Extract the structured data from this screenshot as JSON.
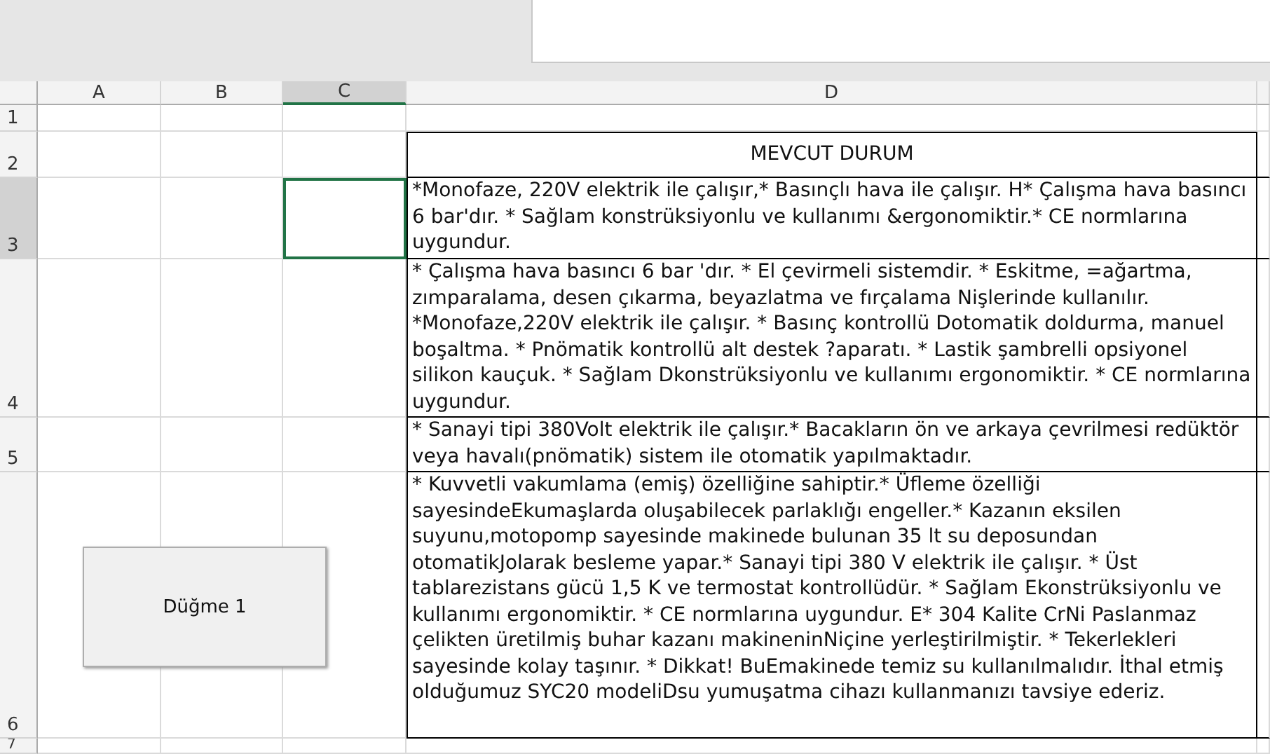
{
  "columns": [
    {
      "label": "A",
      "selected": false
    },
    {
      "label": "B",
      "selected": false
    },
    {
      "label": "C",
      "selected": true
    },
    {
      "label": "D",
      "selected": false
    }
  ],
  "rows": [
    {
      "label": "1",
      "selected": false
    },
    {
      "label": "2",
      "selected": false,
      "kind": "header",
      "text": "MEVCUT DURUM"
    },
    {
      "label": "3",
      "selected": true,
      "kind": "text",
      "text": "*Monofaze, 220V elektrik ile çalışır,* Basınçlı hava ile çalışır. H* Çalışma hava basıncı 6 bar'dır. * Sağlam konstrüksiyonlu ve kullanımı &ergonomiktir.* CE normlarına uygundur."
    },
    {
      "label": "4",
      "selected": false,
      "kind": "text",
      "text": "* Çalışma hava basıncı 6 bar 'dır. * El çevirmeli sistemdir. * Eskitme, =ağartma, zımparalama, desen çıkarma, beyazlatma ve fırçalama Nişlerinde kullanılır. *Monofaze,220V elektrik ile çalışır. * Basınç kontrollü Dotomatik doldurma, manuel boşaltma. * Pnömatik kontrollü alt destek ?aparatı. * Lastik şambrelli opsiyonel silikon kauçuk. * Sağlam Dkonstrüksiyonlu ve kullanımı ergonomiktir. * CE normlarına uygundur."
    },
    {
      "label": "5",
      "selected": false,
      "kind": "text",
      "text": "* Sanayi tipi 380Volt elektrik ile çalışır.* Bacakların ön ve arkaya çevrilmesi redüktör veya havalı(pnömatik) sistem ile otomatik yapılmaktadır."
    },
    {
      "label": "6",
      "selected": false,
      "kind": "text",
      "text": "* Kuvvetli vakumlama (emiş) özelliğine sahiptir.* Üfleme özelliği sayesindeEkumaşlarda oluşabilecek parlaklığı engeller.* Kazanın eksilen suyunu,motopomp sayesinde makinede bulunan 35 lt su deposundan otomatikJolarak besleme yapar.* Sanayi tipi 380 V elektrik ile çalışır. * Üst tablarezistans  gücü 1,5 K  ve termostat kontrollüdür. * Sağlam Ekonstrüksiyonlu ve kullanımı ergonomiktir. * CE normlarına uygundur. E* 304 Kalite CrNi Paslanmaz çelikten üretilmiş buhar kazanı makineninNiçine yerleştirilmiştir. * Tekerlekleri sayesinde kolay  taşınır. * Dikkat! BuEmakinede temiz su kullanılmalıdır. İthal etmiş olduğumuz SYC20 modeliDsu yumuşatma cihazı kullanmanızı tavsiye ederiz."
    },
    {
      "label": "7",
      "selected": false
    }
  ],
  "button": {
    "label": "Düğme 1"
  }
}
